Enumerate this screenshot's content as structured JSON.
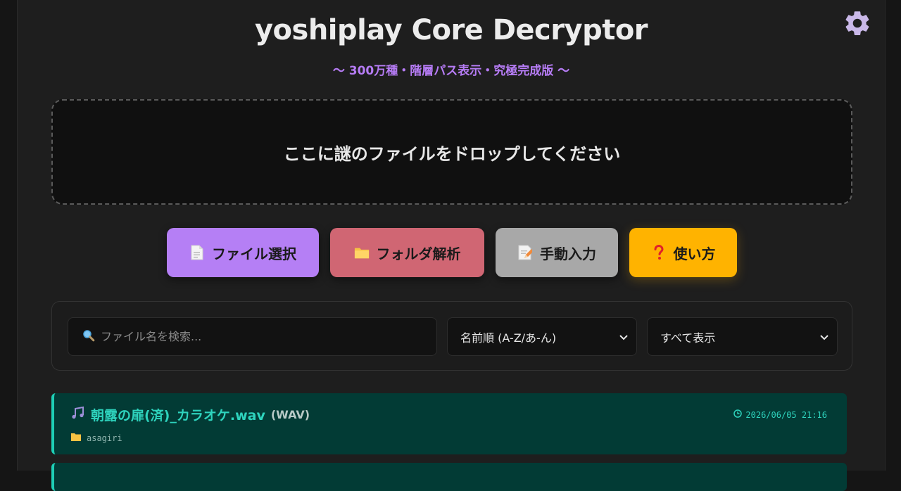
{
  "header": {
    "title": "yoshiplay Core Decryptor",
    "subtitle": "〜 300万種・階層パス表示・究極完成版 〜",
    "settings_icon": "gear-icon"
  },
  "dropzone": {
    "text": "ここに謎のファイルをドロップしてください"
  },
  "actions": {
    "file_select": {
      "label": "ファイル選択",
      "icon": "document-icon",
      "color": "#b57ff5"
    },
    "folder_analyze": {
      "label": "フォルダ解析",
      "icon": "folder-icon",
      "color": "#d06673"
    },
    "manual_input": {
      "label": "手動入力",
      "icon": "memo-icon",
      "color": "#a8a8a8"
    },
    "help": {
      "label": "使い方",
      "icon": "question-icon",
      "color": "#ffb300"
    }
  },
  "filters": {
    "search_placeholder": "ファイル名を検索...",
    "sort_selected": "名前順 (A-Z/あ-ん)",
    "filter_selected": "すべて表示"
  },
  "files": [
    {
      "name": "朝露の扉(済)_カラオケ.wav",
      "type": "(WAV)",
      "timestamp": "2026/06/05 21:16",
      "folder": "asagiri",
      "accent": "#1ecfb6"
    }
  ]
}
